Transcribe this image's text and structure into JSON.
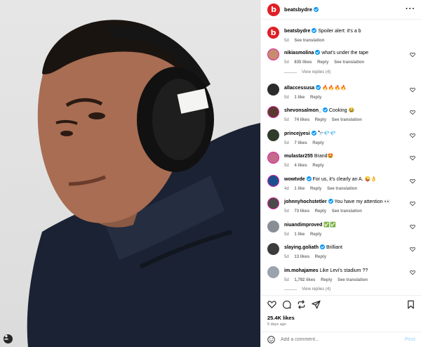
{
  "post": {
    "username": "beatsbydre",
    "caption_text": "Spoiler alert: it's a b",
    "caption_time": "5d",
    "caption_translate": "See translation",
    "likes": "25.4K likes",
    "posted": "5 days ago",
    "add_comment_placeholder": "Add a comment...",
    "post_label": "Post",
    "more_label": "···"
  },
  "comments": [
    {
      "user": "nikiasmolina",
      "verified": true,
      "text": "what's under the tape",
      "time": "5d",
      "likes": "835 likes",
      "reply": "Reply",
      "translate": "See translation",
      "view_replies": "View replies (4)"
    },
    {
      "user": "allaccessusa",
      "verified": true,
      "text": "🔥🔥🔥🔥",
      "time": "5d",
      "likes": "1 like",
      "reply": "Reply"
    },
    {
      "user": "shevonsalmon_",
      "verified": true,
      "text": "Cooking 😂",
      "time": "5d",
      "likes": "74 likes",
      "reply": "Reply",
      "translate": "See translation"
    },
    {
      "user": "princejyesi",
      "verified": true,
      "text": "🔭💎💎",
      "time": "5d",
      "likes": "7 likes",
      "reply": "Reply"
    },
    {
      "user": "mulastar255",
      "verified": false,
      "text": "Brand🤩",
      "time": "5d",
      "likes": "4 likes",
      "reply": "Reply"
    },
    {
      "user": "wowtvde",
      "verified": true,
      "text": "For us, it's clearly an A. 😜👌",
      "time": "4d",
      "likes": "1 like",
      "reply": "Reply",
      "translate": "See translation"
    },
    {
      "user": "johnnyhochstetler",
      "verified": true,
      "text": "You have my attention 👀",
      "time": "5d",
      "likes": "73 likes",
      "reply": "Reply",
      "translate": "See translation"
    },
    {
      "user": "niuandimproved",
      "verified": false,
      "text": "✅✅",
      "time": "5d",
      "likes": "1 like",
      "reply": "Reply"
    },
    {
      "user": "slaying.goliath",
      "verified": true,
      "text": "Brilliant",
      "time": "5d",
      "likes": "13 likes",
      "reply": "Reply"
    },
    {
      "user": "im.mohajames",
      "verified": false,
      "text": "Like Levi's stadium ??",
      "time": "5d",
      "likes": "1,792 likes",
      "reply": "Reply",
      "translate": "See translation",
      "view_replies": "View replies (4)"
    }
  ],
  "icons": {
    "logo": "beats-logo-icon",
    "heart": "heart-icon",
    "comment": "comment-icon",
    "repost": "repost-icon",
    "share": "share-icon",
    "bookmark": "bookmark-icon",
    "emoji": "emoji-icon",
    "tag": "user-tag-icon"
  },
  "colors": {
    "accent": "#0095f6",
    "beats_red": "#e01f26",
    "secondary_text": "#737373"
  }
}
